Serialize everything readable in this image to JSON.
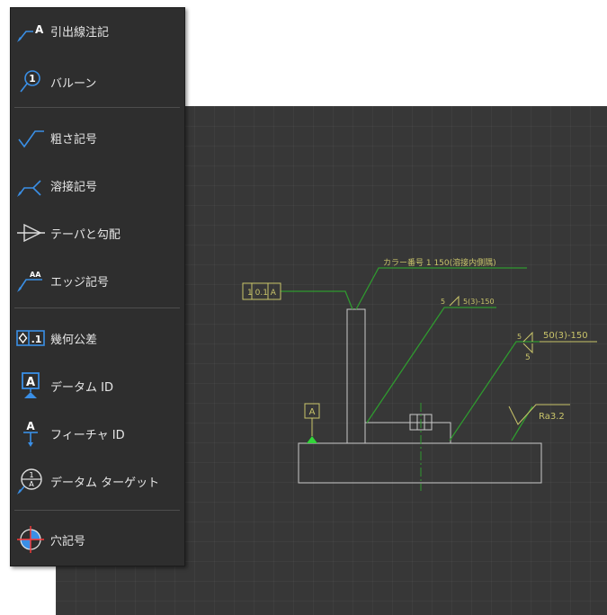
{
  "menu": {
    "items": [
      {
        "label": "引出線注記",
        "icon": "leader-note-icon"
      },
      {
        "label": "バルーン",
        "icon": "balloon-icon"
      },
      {
        "label": "粗さ記号",
        "icon": "surface-roughness-icon"
      },
      {
        "label": "溶接記号",
        "icon": "weld-symbol-icon"
      },
      {
        "label": "テーパと勾配",
        "icon": "taper-slope-icon"
      },
      {
        "label": "エッジ記号",
        "icon": "edge-symbol-icon"
      },
      {
        "label": "幾何公差",
        "icon": "geometric-tolerance-icon"
      },
      {
        "label": "データム ID",
        "icon": "datum-id-icon"
      },
      {
        "label": "フィーチャ ID",
        "icon": "feature-id-icon"
      },
      {
        "label": "データム ターゲット",
        "icon": "datum-target-icon"
      },
      {
        "label": "穴記号",
        "icon": "hole-symbol-icon"
      }
    ],
    "icon_text": {
      "leader": "A",
      "balloon": "1",
      "gdt": ".1",
      "datum": "A",
      "feature": "A",
      "target_top": "1",
      "target_bottom": "A",
      "edge": "AA"
    }
  },
  "drawing": {
    "frame_label": "1 0.1 A",
    "leader_note": "カラー番号 1 150(溶接内側隅)",
    "weld1": "5(3)-150",
    "weld1_small": "5",
    "weld2_top": "50(3)-150",
    "weld2_bottom": "5",
    "weld2_small": "5",
    "datum_label": "A",
    "roughness": "Ra3.2"
  },
  "colors": {
    "menu_bg": "#2e2e2e",
    "canvas_bg": "#373737",
    "icon_blue": "#3a8fe6",
    "annotation_yellow": "#c9c46a",
    "leader_green": "#2f9a2f",
    "datum_green": "#33d63a",
    "part_outline": "#c8c8c8"
  }
}
